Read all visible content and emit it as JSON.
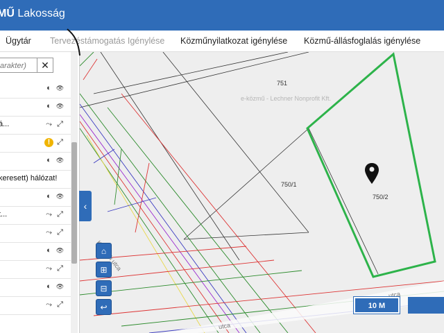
{
  "app": {
    "title_bold": "MŰ",
    "title_rest": " Lakosság"
  },
  "nav": {
    "items": [
      {
        "label": "Ügytár",
        "disabled": false
      },
      {
        "label": "Tervezéstámogatás Igénylése",
        "disabled": true
      },
      {
        "label": "Közműnyilatkozat igénylése",
        "disabled": false
      },
      {
        "label": "Közmű-állásfoglalás igénylése",
        "disabled": false
      }
    ]
  },
  "sidebar": {
    "search_placeholder": "arakter)",
    "clear_symbol": "✕",
    "rows": [
      {
        "label": "",
        "icons": [
          "contrast-icon",
          "eye-icon"
        ]
      },
      {
        "label": "",
        "icons": [
          "contrast-icon",
          "eye-icon"
        ]
      },
      {
        "label": "á...",
        "icons": [
          "share-icon",
          "expand-icon"
        ]
      },
      {
        "label": "",
        "icons": [
          "warning-icon",
          "expand-icon"
        ]
      },
      {
        "label": "",
        "icons": [
          "contrast-icon",
          "eye-icon"
        ]
      },
      {
        "label": "keresett) hálózat!",
        "icons": []
      },
      {
        "label": "",
        "icons": [
          "contrast-icon",
          "eye-icon"
        ]
      },
      {
        "label": "t...",
        "icons": [
          "share-icon",
          "expand-icon"
        ]
      },
      {
        "label": "",
        "icons": [
          "share-icon",
          "expand-icon"
        ]
      },
      {
        "label": "",
        "icons": [
          "contrast-icon",
          "eye-icon"
        ]
      },
      {
        "label": "",
        "icons": [
          "share-icon",
          "expand-icon"
        ]
      },
      {
        "label": "",
        "icons": [
          "contrast-icon",
          "eye-icon"
        ]
      },
      {
        "label": "",
        "icons": [
          "share-icon",
          "expand-icon"
        ]
      }
    ]
  },
  "map": {
    "parcels": {
      "p751": "751",
      "p750_1": "750/1",
      "p750_2": "750/2"
    },
    "watermark": "e-közmű - Lechner Nonprofit Kft.",
    "streets": {
      "kossuth": "Kossuth utca",
      "utca_right": "utca",
      "utca_bottom": "utca"
    },
    "scale_label": "10 M",
    "scale_label2": "",
    "colors": {
      "selection": "#2db34a",
      "accent": "#2f6cb8"
    }
  },
  "controls": {
    "home": "⌂",
    "zoom_in": "⊞",
    "zoom_out": "⊟",
    "back": "↩",
    "collapse": "‹"
  }
}
